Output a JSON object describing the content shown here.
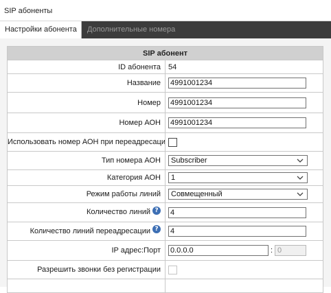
{
  "window": {
    "title": "SIP абоненты"
  },
  "tabs": [
    {
      "label": "Настройки абонента",
      "active": true
    },
    {
      "label": "Дополнительные номера",
      "active": false
    }
  ],
  "form": {
    "header": "SIP абонент",
    "subscriber_id": {
      "label": "ID абонента",
      "value": "54"
    },
    "name": {
      "label": "Название",
      "value": "4991001234"
    },
    "number": {
      "label": "Номер",
      "value": "4991001234"
    },
    "aon_number": {
      "label": "Номер АОН",
      "value": "4991001234"
    },
    "use_aon_on_forward": {
      "label": "Использовать номер АОН при переадресации",
      "checked": false
    },
    "aon_type": {
      "label": "Тип номера АОН",
      "value": "Subscriber"
    },
    "aon_category": {
      "label": "Категория АОН",
      "value": "1"
    },
    "line_mode": {
      "label": "Режим работы линий",
      "value": "Совмещенный"
    },
    "line_count": {
      "label": "Количество линий",
      "value": "4"
    },
    "forward_line_count": {
      "label": "Количество линий переадресации",
      "value": "4"
    },
    "ip_port": {
      "label": "IP адрес:Порт",
      "ip": "0.0.0.0",
      "separator": ":",
      "port": "0"
    },
    "allow_unregistered": {
      "label": "Разрешить звонки без регистрации",
      "checked": false
    }
  },
  "icons": {
    "help": "help-icon",
    "dropdown": "chevron-down-icon"
  },
  "colors": {
    "tab_bar": "#3c3c3c",
    "header_bg": "#d0d0d0",
    "help_icon": "#3d6fb4",
    "content_bg": "#f4f4f4"
  }
}
